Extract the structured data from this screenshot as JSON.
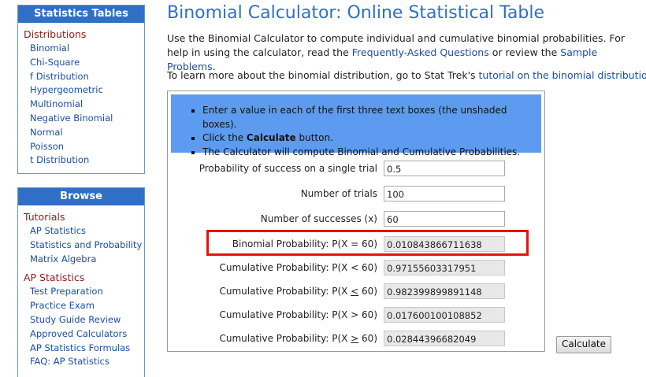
{
  "sidebar": {
    "stats_tables": {
      "header": "Statistics Tables",
      "section": "Distributions",
      "items": [
        "Binomial",
        "Chi-Square",
        "f Distribution",
        "Hypergeometric",
        "Multinomial",
        "Negative Binomial",
        "Normal",
        "Poisson",
        "t Distribution"
      ]
    },
    "browse": {
      "header": "Browse",
      "tutorials_section": "Tutorials",
      "tutorials": [
        "AP Statistics",
        "Statistics and Probability",
        "Matrix Algebra"
      ],
      "ap_section": "AP Statistics",
      "ap_items": [
        "Test Preparation",
        "Practice Exam",
        "Study Guide Review",
        "Approved Calculators",
        "AP Statistics Formulas",
        "FAQ: AP Statistics"
      ]
    }
  },
  "main": {
    "title": "Binomial Calculator: Online Statistical Table",
    "intro": {
      "text1": "Use the Binomial Calculator to compute individual and cumulative binomial probabilities. For help in using the calculator, read the ",
      "link1": "Frequently-Asked Questions",
      "text2": " or review the ",
      "link2": "Sample Problems",
      "text3": "."
    },
    "learn": {
      "text1": "To learn more about the binomial distribution, go to Stat Trek's ",
      "link": "tutorial on the binomial distribution",
      "text2": "."
    },
    "instructions": {
      "item1": "Enter a value in each of the first three text boxes (the unshaded boxes).",
      "item2_pre": "Click the ",
      "item2_bold": "Calculate",
      "item2_post": " button.",
      "item3": "The Calculator will compute Binomial and Cumulative Probabilities."
    },
    "fields": {
      "p_label": "Probability of success on a single trial",
      "p_value": "0.5",
      "n_label": "Number of trials",
      "n_value": "100",
      "x_label": "Number of successes (x)",
      "x_value": "60",
      "binom_label": "Binomial Probability: P(X = 60)",
      "binom_value": "0.010843866711638",
      "lt_label": "Cumulative Probability: P(X < 60)",
      "lt_value": "0.97155603317951",
      "le_label_pre": "Cumulative Probability: P(X ",
      "le_symbol": "<",
      "le_label_post": " 60)",
      "le_value": "0.982399899891148",
      "gt_label": "Cumulative Probability: P(X > 60)",
      "gt_value": "0.017600100108852",
      "ge_label_pre": "Cumulative Probability: P(X ",
      "ge_symbol": ">",
      "ge_label_post": " 60)",
      "ge_value": "0.02844396682049"
    },
    "calculate_label": "Calculate",
    "highlight_color": "#e8120f",
    "accent_color": "#2f6fc6"
  }
}
